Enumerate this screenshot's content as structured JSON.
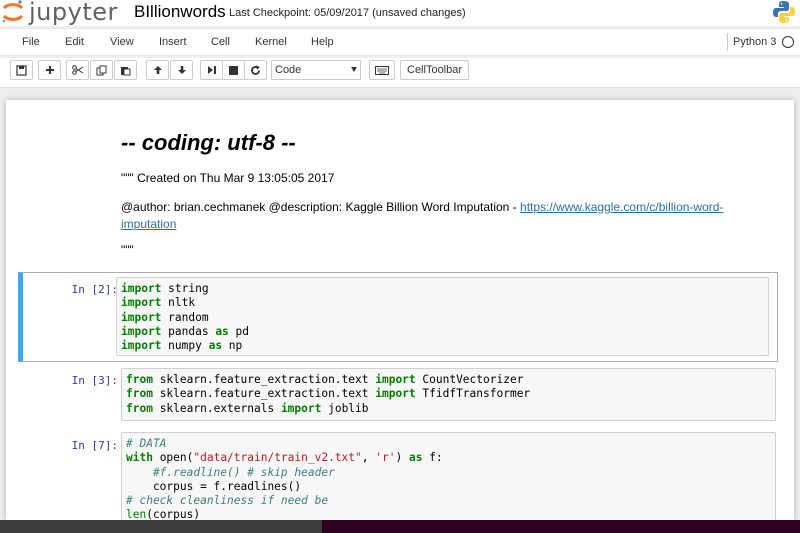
{
  "header": {
    "logo_text": "jupyter",
    "notebook_name": "BIllionwords",
    "checkpoint": "Last Checkpoint: 05/09/2017 (unsaved changes)"
  },
  "menu": {
    "items": [
      "File",
      "Edit",
      "View",
      "Insert",
      "Cell",
      "Kernel",
      "Help"
    ],
    "kernel": "Python 3"
  },
  "toolbar": {
    "cell_type": "Code",
    "celltoolbar_label": "CellToolbar",
    "icons": [
      "save-icon",
      "plus-icon",
      "cut-icon",
      "copy-icon",
      "paste-icon",
      "arrow-up-icon",
      "arrow-down-icon",
      "run-icon",
      "stop-icon",
      "restart-icon",
      "keyboard-icon"
    ]
  },
  "markdown": {
    "heading": "-- coding: utf-8 --",
    "created": "\"\"\" Created on Thu Mar 9 13:05:05 2017",
    "author_text": "@author: brian.cechmanek @description: Kaggle Billion Word Imputation - ",
    "link_text": "https://www.kaggle.com/c/billion-word-imputation",
    "closing_quotes": "\"\"\""
  },
  "cells": [
    {
      "prompt": "In [2]:"
    },
    {
      "prompt": "In [3]:"
    },
    {
      "prompt": "In [7]:"
    }
  ],
  "code": {
    "c2": [
      [
        "import",
        " string"
      ],
      [
        "import",
        " nltk"
      ],
      [
        "import",
        " random"
      ],
      [
        "import",
        " pandas ",
        "as",
        " pd"
      ],
      [
        "import",
        " numpy ",
        "as",
        " np"
      ]
    ],
    "c3": [
      [
        "from",
        " sklearn.feature_extraction.text ",
        "import",
        " CountVectorizer"
      ],
      [
        "from",
        " sklearn.feature_extraction.text ",
        "import",
        " TfidfTransformer"
      ],
      [
        "from",
        " sklearn.externals ",
        "import",
        " joblib"
      ]
    ],
    "c7": {
      "l1": "# DATA",
      "l2_kw": "with",
      "l2_a": " open(",
      "l2_s1": "\"data/train/train_v2.txt\"",
      "l2_b": ", ",
      "l2_s2": "'r'",
      "l2_c": ") ",
      "l2_kw2": "as",
      "l2_d": " f:",
      "l3": "    #f.readline() # skip header",
      "l4": "    corpus = f.readlines()",
      "l5": "# check cleanliness if need be",
      "l6_fn": "len",
      "l6_rest": "(corpus)"
    }
  }
}
